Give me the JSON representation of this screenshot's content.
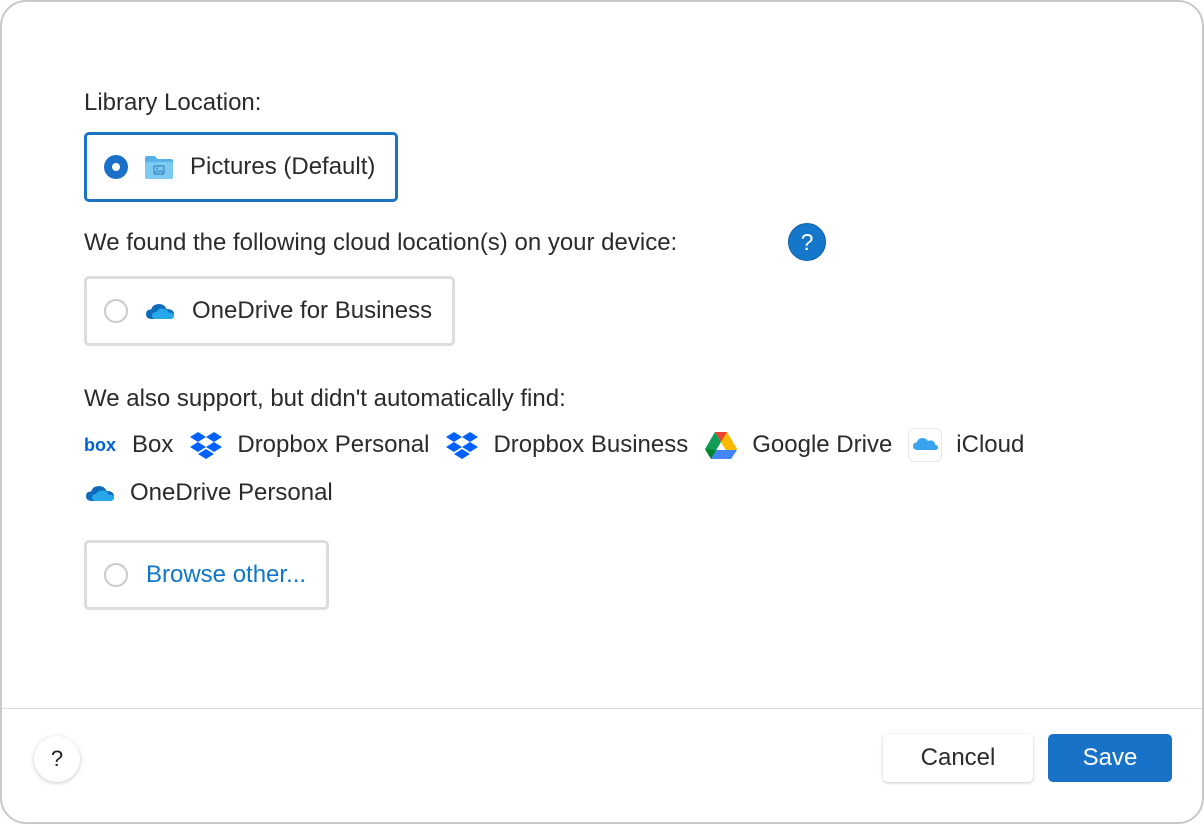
{
  "library_location": {
    "label": "Library Location:",
    "default_option": {
      "label": "Pictures (Default)",
      "icon": "folder-icon",
      "selected": true
    }
  },
  "cloud_found": {
    "label": "We found the following cloud location(s) on your device:",
    "help_label": "?",
    "options": [
      {
        "label": "OneDrive for Business",
        "icon": "onedrive-icon",
        "selected": false
      }
    ]
  },
  "also_supported": {
    "label": "We also support, but didn't automatically find:",
    "providers": [
      {
        "label": "Box",
        "icon": "box-logo-icon"
      },
      {
        "label": "Dropbox Personal",
        "icon": "dropbox-icon"
      },
      {
        "label": "Dropbox Business",
        "icon": "dropbox-icon"
      },
      {
        "label": "Google Drive",
        "icon": "google-drive-icon"
      },
      {
        "label": "iCloud",
        "icon": "icloud-icon"
      },
      {
        "label": "OneDrive Personal",
        "icon": "onedrive-icon"
      }
    ]
  },
  "browse_other": {
    "label": "Browse other..."
  },
  "footer": {
    "help_label": "?",
    "cancel_label": "Cancel",
    "save_label": "Save"
  },
  "colors": {
    "accent": "#1872c7",
    "link": "#0f76c8",
    "border": "#dcdcdc"
  }
}
